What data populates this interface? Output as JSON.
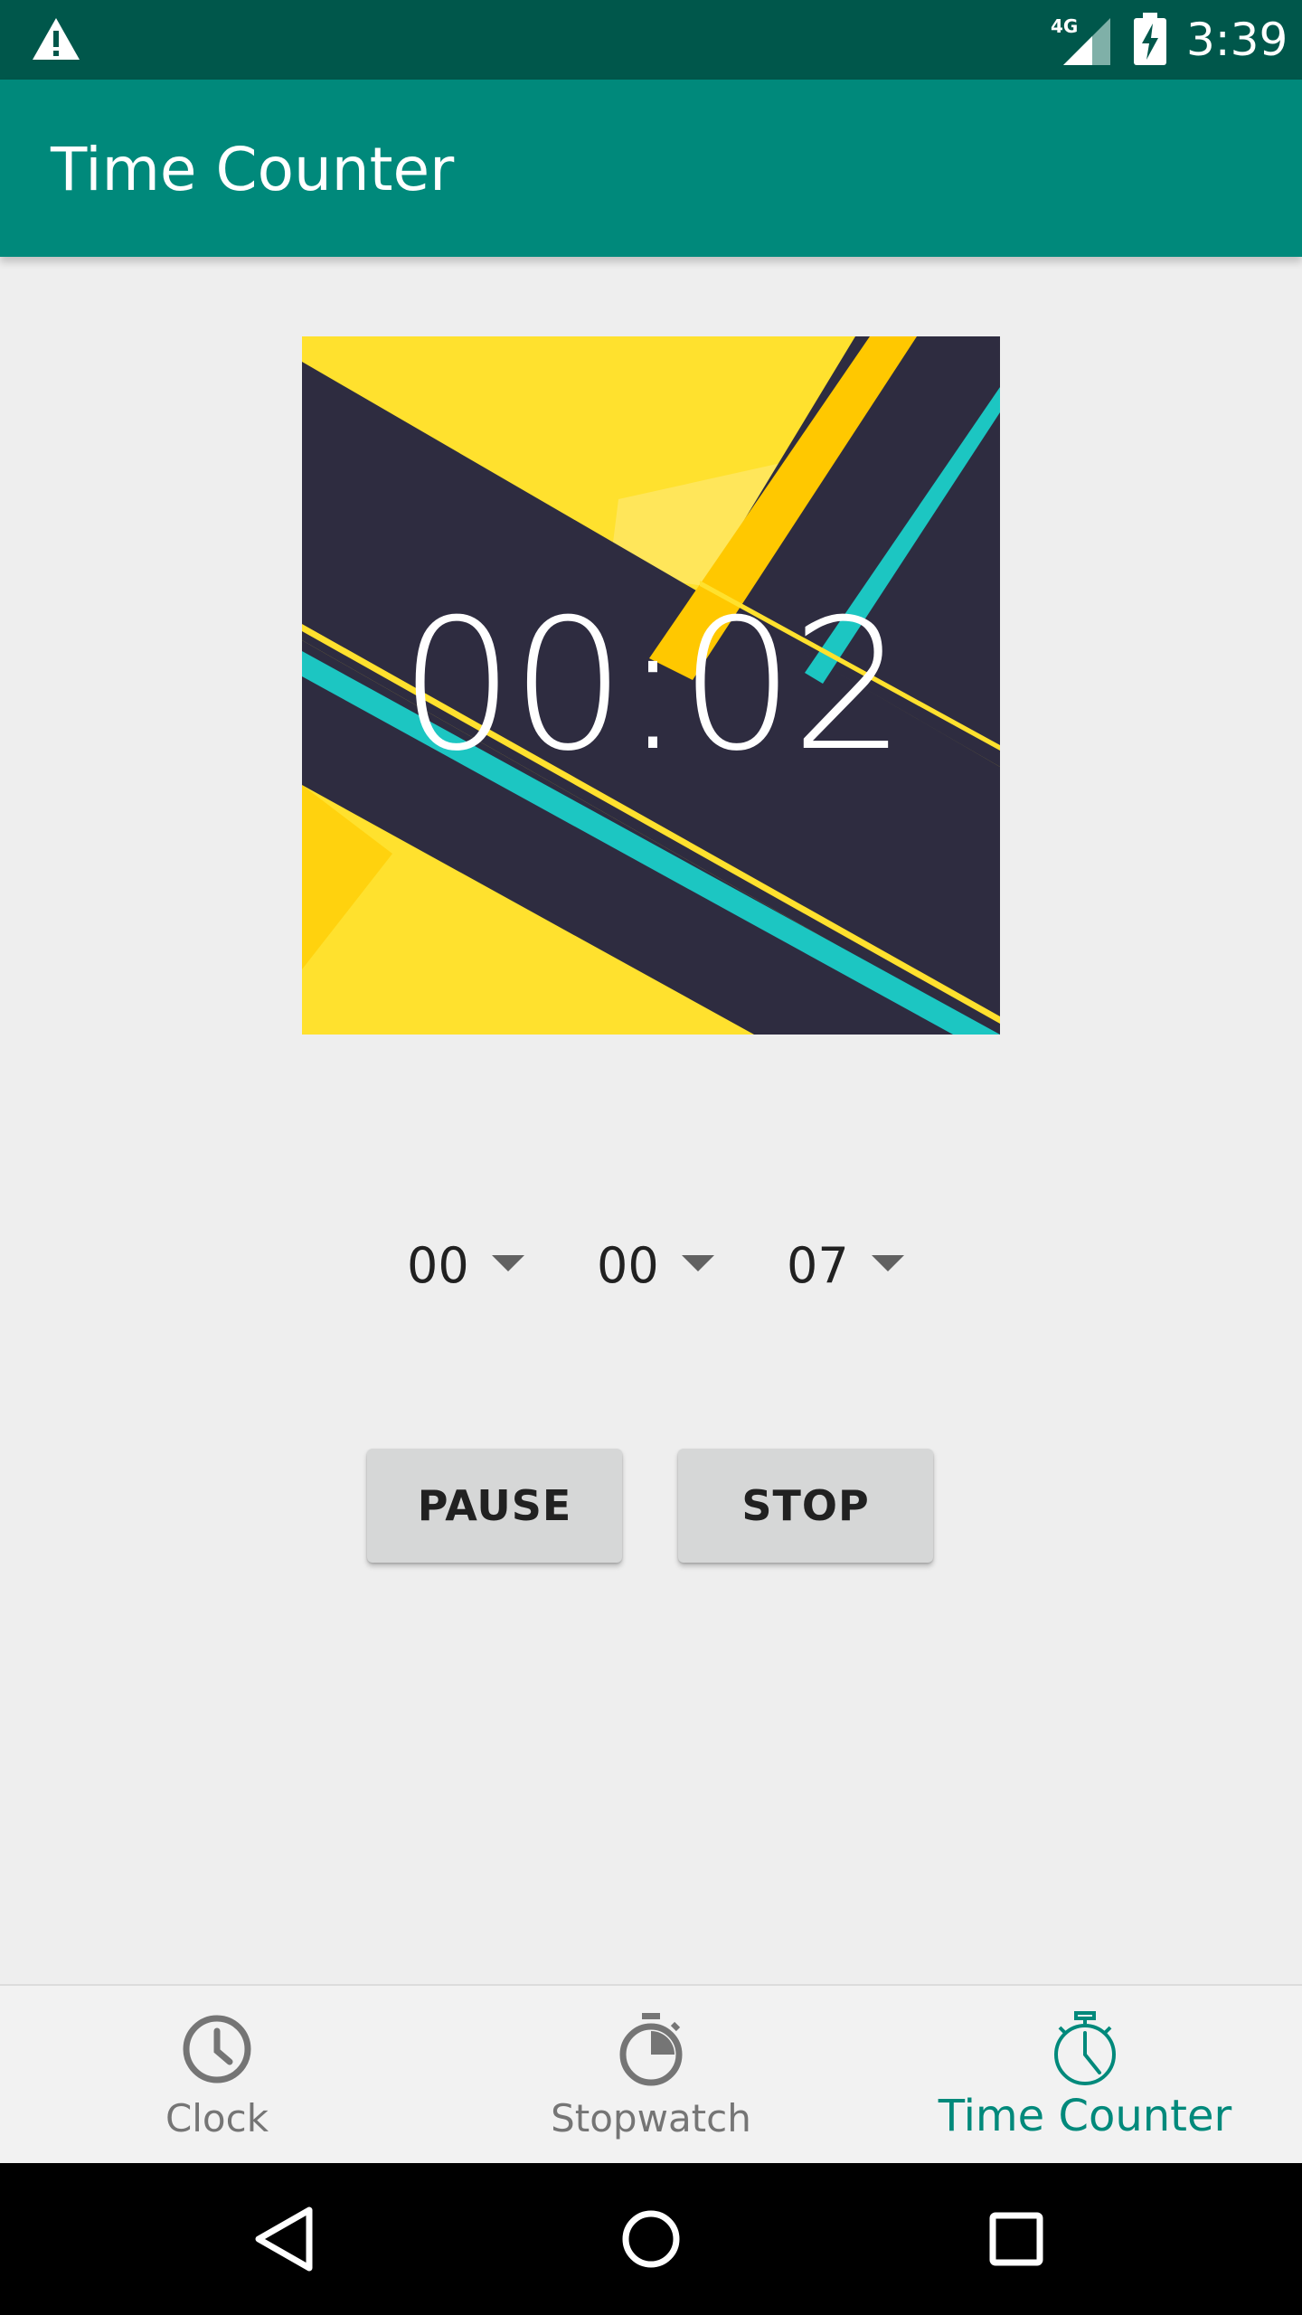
{
  "status_bar": {
    "network": "4G",
    "time": "3:39",
    "icons": [
      "warning-icon",
      "signal-icon",
      "battery-charging-icon"
    ]
  },
  "app_bar": {
    "title": "Time Counter"
  },
  "timer": {
    "display": "00:02"
  },
  "pickers": [
    {
      "value": "00"
    },
    {
      "value": "00"
    },
    {
      "value": "07"
    }
  ],
  "buttons": {
    "pause": "PAUSE",
    "stop": "STOP"
  },
  "bottom_nav": {
    "items": [
      {
        "label": "Clock",
        "icon": "clock-icon",
        "active": false
      },
      {
        "label": "Stopwatch",
        "icon": "stopwatch-icon",
        "active": false
      },
      {
        "label": "Time Counter",
        "icon": "timer-icon",
        "active": true
      }
    ]
  },
  "system_nav": {
    "icons": [
      "back-icon",
      "home-icon",
      "recents-icon"
    ]
  },
  "colors": {
    "status_bar": "#00574b",
    "app_bar": "#00897b",
    "accent": "#00897b",
    "art_dark": "#2e2c40",
    "art_yellow": "#ffe12e",
    "art_cyan": "#1cc6c2"
  }
}
